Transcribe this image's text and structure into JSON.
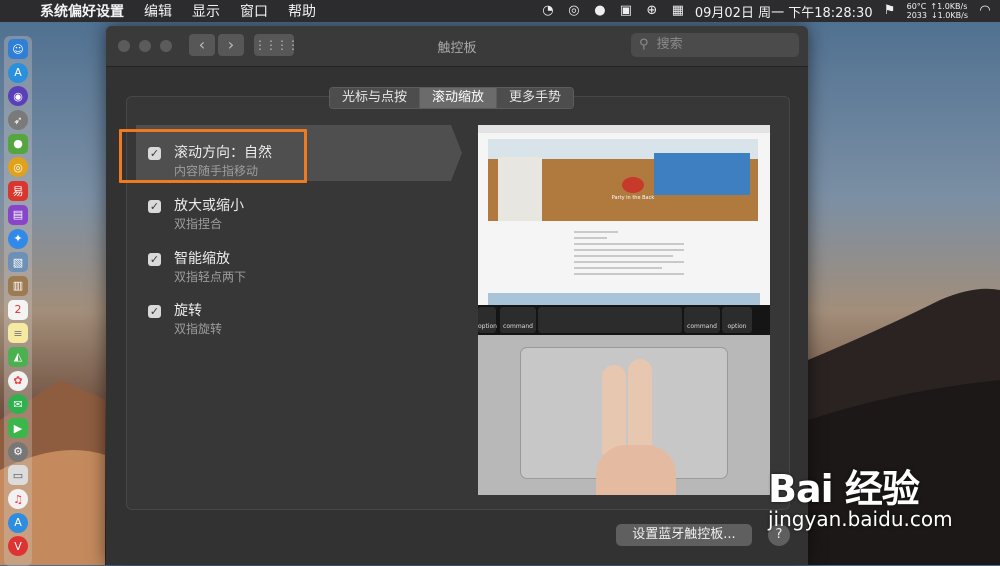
{
  "menubar": {
    "apple": "",
    "app_name": "系统偏好设置",
    "menus": [
      "编辑",
      "显示",
      "窗口",
      "帮助"
    ],
    "clock": "09月02日 周一 下午18:28:30",
    "temp": "60°C",
    "fan": "2033",
    "upload": "↑1.0KB/s",
    "download": "↓1.0KB/s"
  },
  "window": {
    "title": "触控板",
    "search_placeholder": "搜索",
    "tabs": [
      {
        "label": "光标与点按",
        "active": false
      },
      {
        "label": "滚动缩放",
        "active": true
      },
      {
        "label": "更多手势",
        "active": false
      }
    ],
    "options": [
      {
        "title": "滚动方向：自然",
        "subtitle": "内容随手指移动",
        "checked": true,
        "selected": true
      },
      {
        "title": "放大或缩小",
        "subtitle": "双指捏合",
        "checked": true,
        "selected": false
      },
      {
        "title": "智能缩放",
        "subtitle": "双指轻点两下",
        "checked": true,
        "selected": false
      },
      {
        "title": "旋转",
        "subtitle": "双指旋转",
        "checked": true,
        "selected": false
      }
    ],
    "preview": {
      "key_left": "command",
      "key_right": "command",
      "opt_left": "option",
      "opt_right": "option",
      "caption": "Party in the Back"
    },
    "bluetooth_button": "设置蓝牙触控板...",
    "help_label": "?"
  },
  "watermark": {
    "logo": "Bai 经验",
    "url": "jingyan.baidu.com"
  },
  "colors": {
    "highlight": "#f07a20"
  }
}
